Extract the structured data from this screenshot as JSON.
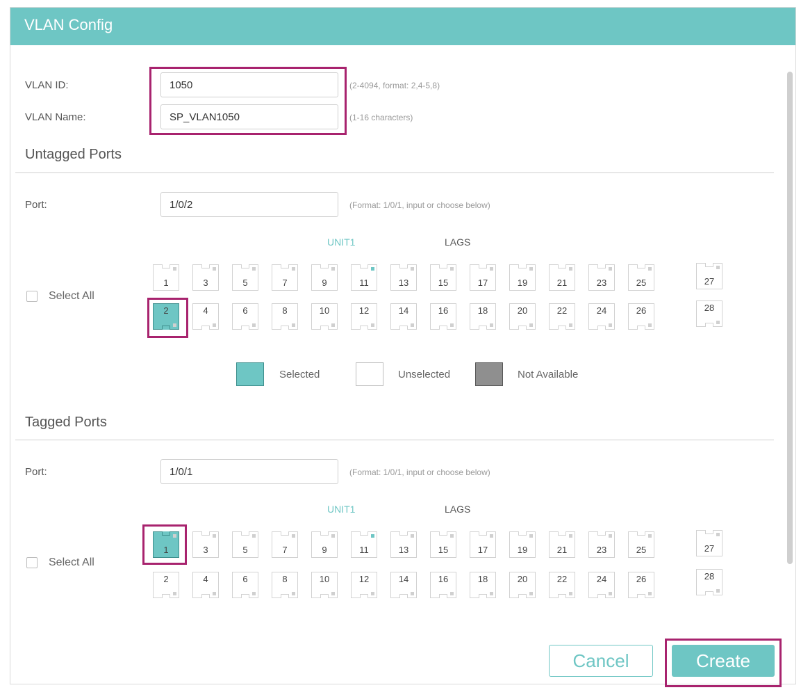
{
  "dialog": {
    "title": "VLAN Config"
  },
  "form": {
    "vlan_id_label": "VLAN ID:",
    "vlan_id_value": "1050",
    "vlan_id_hint": "(2-4094, format: 2,4-5,8)",
    "vlan_name_label": "VLAN Name:",
    "vlan_name_value": "SP_VLAN1050",
    "vlan_name_hint": "(1-16 characters)"
  },
  "untagged": {
    "section_title": "Untagged Ports",
    "port_label": "Port:",
    "port_value": "1/0/2",
    "port_hint": "(Format: 1/0/1, input or choose below)",
    "unit_label": "UNIT1",
    "lags_label": "LAGS",
    "select_all_label": "Select All",
    "top_ports": [
      "1",
      "3",
      "5",
      "7",
      "9",
      "11",
      "13",
      "15",
      "17",
      "19",
      "21",
      "23",
      "25"
    ],
    "bottom_ports": [
      "2",
      "4",
      "6",
      "8",
      "10",
      "12",
      "14",
      "16",
      "18",
      "20",
      "22",
      "24",
      "26"
    ],
    "lag_top": "27",
    "lag_bottom": "28",
    "selected_ports": [
      "2"
    ]
  },
  "legend": {
    "selected": "Selected",
    "unselected": "Unselected",
    "not_available": "Not Available"
  },
  "tagged": {
    "section_title": "Tagged Ports",
    "port_label": "Port:",
    "port_value": "1/0/1",
    "port_hint": "(Format: 1/0/1, input or choose below)",
    "unit_label": "UNIT1",
    "lags_label": "LAGS",
    "select_all_label": "Select All",
    "top_ports": [
      "1",
      "3",
      "5",
      "7",
      "9",
      "11",
      "13",
      "15",
      "17",
      "19",
      "21",
      "23",
      "25"
    ],
    "bottom_ports": [
      "2",
      "4",
      "6",
      "8",
      "10",
      "12",
      "14",
      "16",
      "18",
      "20",
      "22",
      "24",
      "26"
    ],
    "lag_top": "27",
    "lag_bottom": "28",
    "selected_ports": [
      "1"
    ]
  },
  "buttons": {
    "cancel": "Cancel",
    "create": "Create"
  },
  "colors": {
    "accent": "#6ec6c4",
    "highlight": "#a8236e"
  }
}
